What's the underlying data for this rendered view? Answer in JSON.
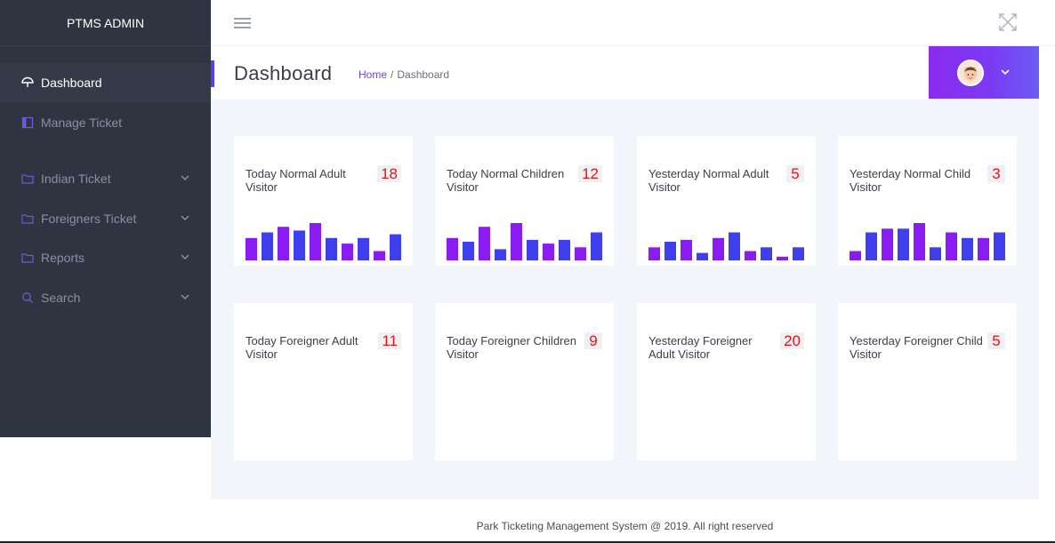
{
  "app": {
    "brand": "PTMS ADMIN"
  },
  "sidebar": {
    "items": [
      {
        "label": "Dashboard",
        "icon": "umbrella-icon",
        "active": true
      },
      {
        "label": "Manage Ticket",
        "icon": "columns-icon"
      },
      {
        "label": "Indian Ticket",
        "icon": "folder-icon",
        "expandable": true
      },
      {
        "label": "Foreigners Ticket",
        "icon": "folder-icon",
        "expandable": true
      },
      {
        "label": "Reports",
        "icon": "folder-icon",
        "expandable": true
      },
      {
        "label": "Search",
        "icon": "search-icon",
        "expandable": true
      }
    ]
  },
  "header": {
    "title": "Dashboard",
    "breadcrumb": {
      "home": "Home",
      "separator": "/",
      "current": "Dashboard"
    }
  },
  "colors": {
    "accent": "#7b3af2",
    "sidebar": "#2f3441",
    "bar_purple": "#8a1cf2",
    "bar_blue": "#3f3fee",
    "count_red": "#e81414"
  },
  "cards": [
    {
      "label": "Today Normal Adult Visitor",
      "count": "18",
      "bars": [
        24,
        30,
        36,
        32,
        40,
        24,
        18,
        24,
        10,
        28
      ]
    },
    {
      "label": "Today Normal Children Visitor",
      "count": "12",
      "bars": [
        24,
        20,
        36,
        12,
        40,
        22,
        18,
        22,
        14,
        30
      ]
    },
    {
      "label": "Yesterday Normal Adult Visitor",
      "count": "5",
      "bars": [
        14,
        20,
        22,
        8,
        24,
        30,
        10,
        14,
        4,
        14
      ]
    },
    {
      "label": "Yesterday Normal Child Visitor",
      "count": "3",
      "bars": [
        10,
        30,
        34,
        34,
        40,
        14,
        30,
        24,
        24,
        30
      ]
    },
    {
      "label": "Today Foreigner Adult Visitor",
      "count": "11",
      "bars": []
    },
    {
      "label": "Today Foreigner Children Visitor",
      "count": "9",
      "bars": []
    },
    {
      "label": "Yesterday Foreigner Adult Visitor",
      "count": "20",
      "bars": []
    },
    {
      "label": "Yesterday Foreigner Child Visitor",
      "count": "5",
      "bars": []
    }
  ],
  "footer": {
    "text": "Park Ticketing Management System @ 2019. All right reserved"
  }
}
